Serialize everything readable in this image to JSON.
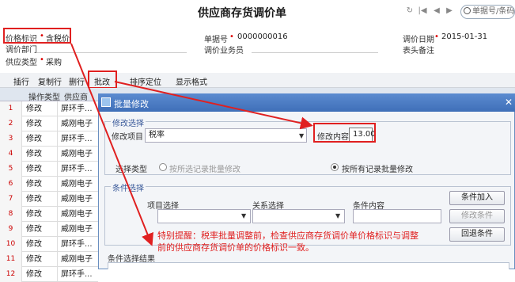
{
  "header": {
    "title": "供应商存货调价单",
    "search_placeholder": "单据号/条码"
  },
  "nav_icons": [
    "refresh-icon",
    "first-icon",
    "prev-icon",
    "next-icon",
    "last-icon"
  ],
  "form": {
    "price_flag_label": "价格标识",
    "price_flag_value": "含税价",
    "dept_label": "调价部门",
    "supplier_type_label": "供应类型",
    "supplier_type_value": "采购",
    "doc_no_label": "单据号",
    "doc_no_value": "0000000016",
    "salesman_label": "调价业务员",
    "date_label": "调价日期",
    "date_value": "2015-01-31",
    "remark_label": "表头备注"
  },
  "toolbar": {
    "insert": "插行",
    "copy": "复制行",
    "delete": "删行",
    "batch": "批改",
    "sort": "排序定位",
    "display": "显示格式"
  },
  "grid": {
    "headers": [
      "操作类型",
      "供应商",
      "供应商"
    ],
    "rows": [
      {
        "no": "1",
        "op": "修改",
        "sup": "屏环手..."
      },
      {
        "no": "2",
        "op": "修改",
        "sup": "威刚电子"
      },
      {
        "no": "3",
        "op": "修改",
        "sup": "屏环手..."
      },
      {
        "no": "4",
        "op": "修改",
        "sup": "威刚电子"
      },
      {
        "no": "5",
        "op": "修改",
        "sup": "屏环手..."
      },
      {
        "no": "6",
        "op": "修改",
        "sup": "威刚电子"
      },
      {
        "no": "7",
        "op": "修改",
        "sup": "威刚电子"
      },
      {
        "no": "8",
        "op": "修改",
        "sup": "威刚电子"
      },
      {
        "no": "9",
        "op": "修改",
        "sup": "威刚电子"
      },
      {
        "no": "10",
        "op": "修改",
        "sup": "屏环手..."
      },
      {
        "no": "11",
        "op": "修改",
        "sup": "威刚电子"
      },
      {
        "no": "12",
        "op": "修改",
        "sup": "屏环手..."
      }
    ]
  },
  "dialog": {
    "title": "批量修改",
    "modify_group": "修改选择",
    "item_label": "修改项目",
    "item_value": "税率",
    "content_label": "修改内容",
    "content_value": "13.00",
    "select_type_label": "选择类型",
    "radio_selected_only": "按所选记录批量修改",
    "radio_all": "按所有记录批量修改",
    "cond_group": "条件选择",
    "project_label": "项目选择",
    "relation_label": "关系选择",
    "cond_content_label": "条件内容",
    "btn_add": "条件加入",
    "btn_modify": "修改条件",
    "btn_back": "回退条件",
    "result_label": "条件选择结果"
  },
  "note": "特别提醒：税率批量调整前，检查供应商存货调价单价格标识与调整前的供应商存货调价单的价格标识一致。",
  "colors": {
    "annotation": "#e02020",
    "accent": "#3f6fb8"
  }
}
